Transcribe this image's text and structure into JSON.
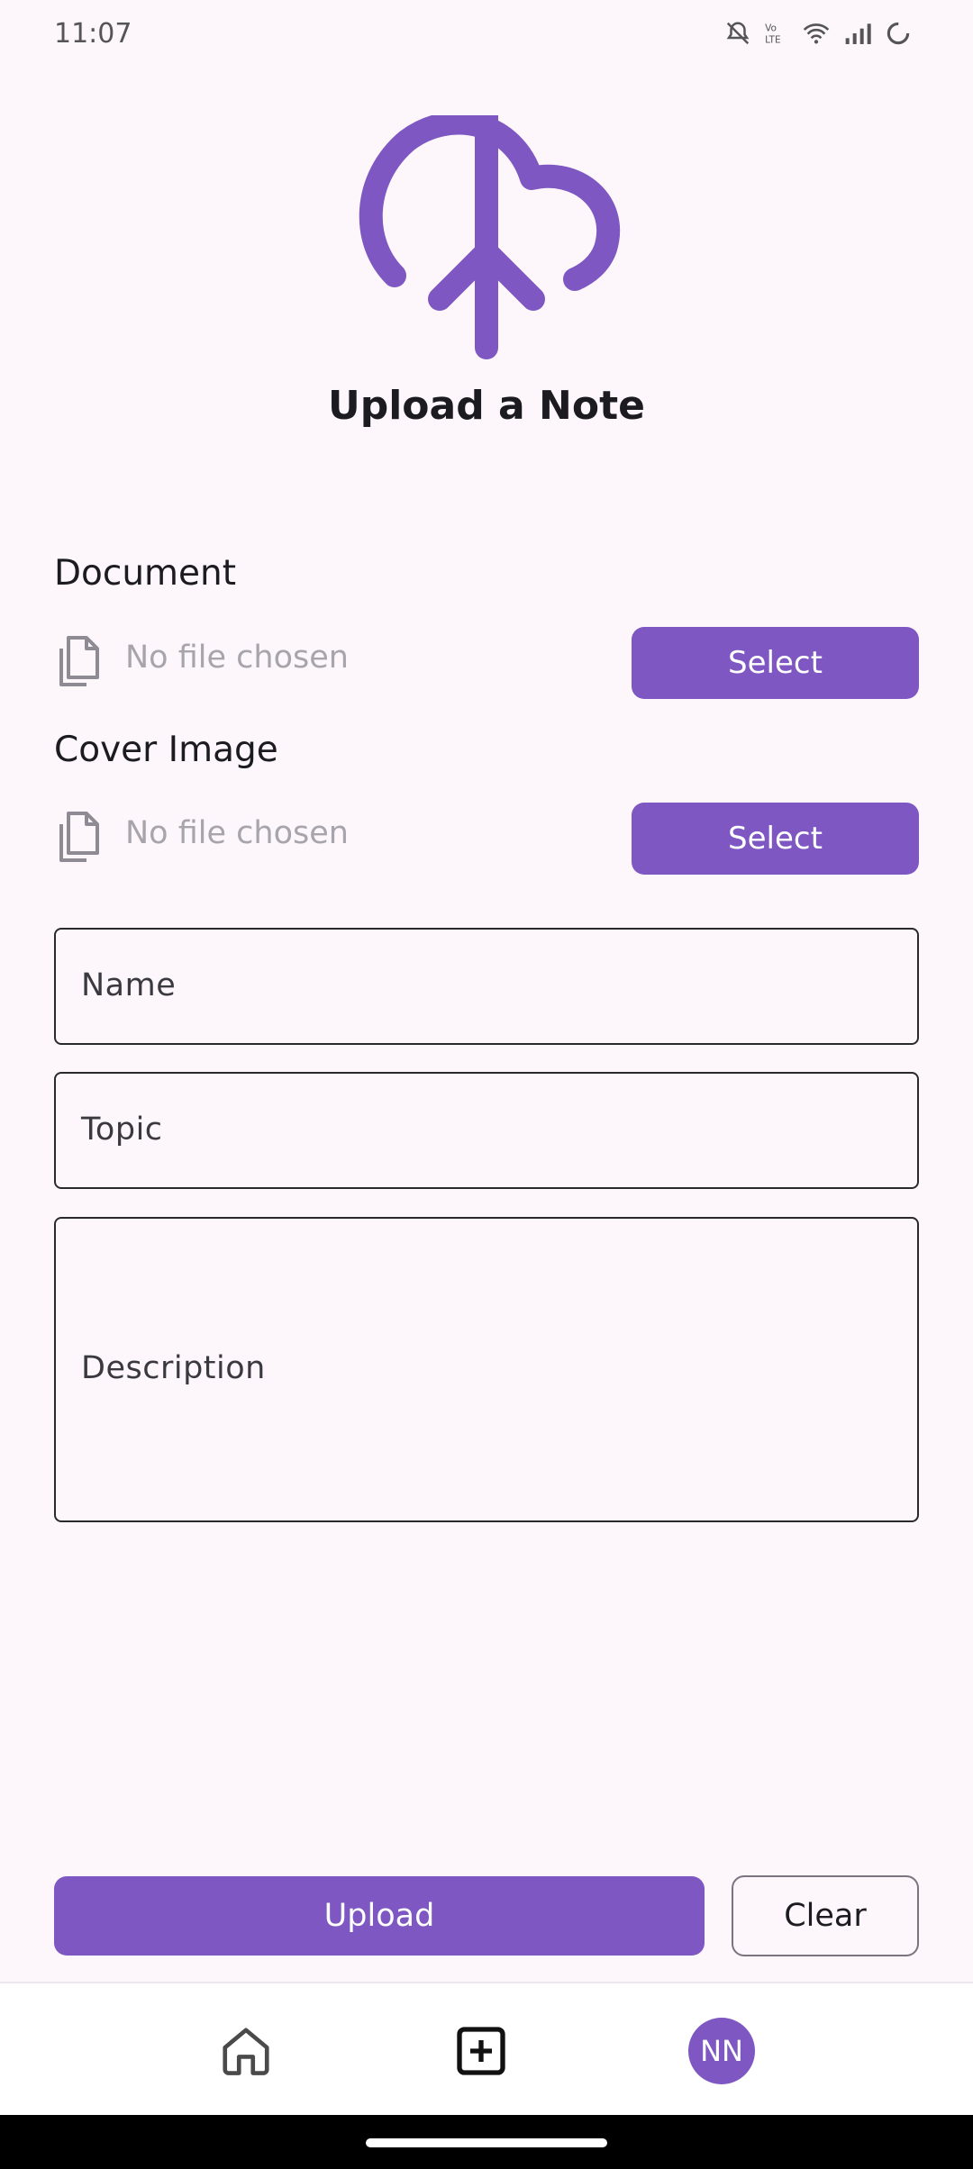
{
  "status_bar": {
    "time": "11:07"
  },
  "header": {
    "icon": "cloud-upload-icon",
    "title": "Upload a Note"
  },
  "document": {
    "label": "Document",
    "file_status": "No file chosen",
    "select_label": "Select"
  },
  "cover_image": {
    "label": "Cover Image",
    "file_status": "No file chosen",
    "select_label": "Select"
  },
  "form": {
    "name_label": "Name",
    "topic_label": "Topic",
    "description_label": "Description"
  },
  "actions": {
    "upload_label": "Upload",
    "clear_label": "Clear"
  },
  "bottom_nav": {
    "avatar_initials": "NN",
    "items": [
      "home-icon",
      "add-box-icon",
      "avatar"
    ]
  },
  "colors": {
    "accent": "#7e57c2",
    "background": "#fdf7fc"
  }
}
